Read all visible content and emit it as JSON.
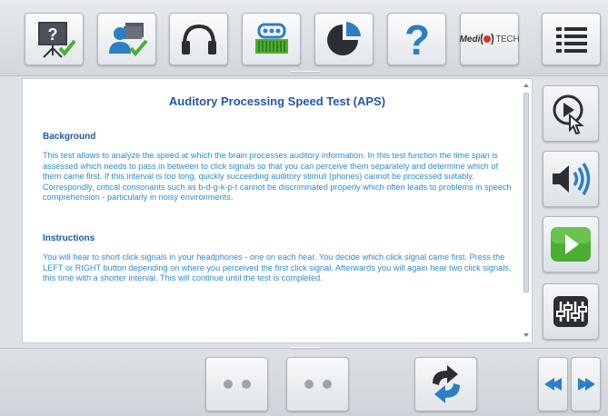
{
  "toolbar": {
    "items": [
      {
        "icon": "presentation-check-icon"
      },
      {
        "icon": "user-folder-check-icon"
      },
      {
        "icon": "headphones-icon"
      },
      {
        "icon": "audiometer-device-icon"
      },
      {
        "icon": "pie-chart-icon"
      },
      {
        "icon": "help-icon"
      },
      {
        "icon": "meditech-logo"
      },
      {
        "icon": "menu-list-icon"
      }
    ],
    "logo": {
      "prefix": "Medi",
      "suffix": "TECH"
    }
  },
  "content": {
    "title": "Auditory Processing Speed Test (APS)",
    "background_heading": "Background",
    "background_text": "This test allows to analyze the speed at which the brain processes auditory information. In this test function the time span is assessed which needs to pass in between to click signals so that you can perceive them separately and determine which of them came first. If this interval is too long, quickly succeeding auditory stimuli (phones) cannot be processed suitably. Correspondly, critical consonants such as b-d-g-k-p-t cannot be discriminated properly which often leads to problems in speech comprehension - particularly in noisy environments.",
    "instructions_heading": "Instructions",
    "instructions_text": "You will hear to short click signals in your headphones - one on each hear. You decide which click signal came first. Press the LEFT or RIGHT button depending on where you perceived the first click signal. Afterwards you will again hear two click signals, this time with a shorter interval. This will continue until the test is completed."
  },
  "sidebar": {
    "buttons": [
      {
        "icon": "play-pointer-icon"
      },
      {
        "icon": "speaker-volume-icon"
      },
      {
        "icon": "play-green-icon"
      },
      {
        "icon": "mixer-settings-icon"
      }
    ]
  },
  "bottombar": {
    "buttons": [
      {
        "icon": "left-click-dots"
      },
      {
        "icon": "right-click-dots"
      },
      {
        "icon": "refresh-arrows-icon"
      },
      {
        "icon": "previous-arrow-icon"
      },
      {
        "icon": "next-arrow-icon"
      }
    ]
  },
  "colors": {
    "title": "#2257a8",
    "body_text": "#2e8bd0",
    "check_green": "#4caf33",
    "icon_blue": "#2d7fc4"
  }
}
